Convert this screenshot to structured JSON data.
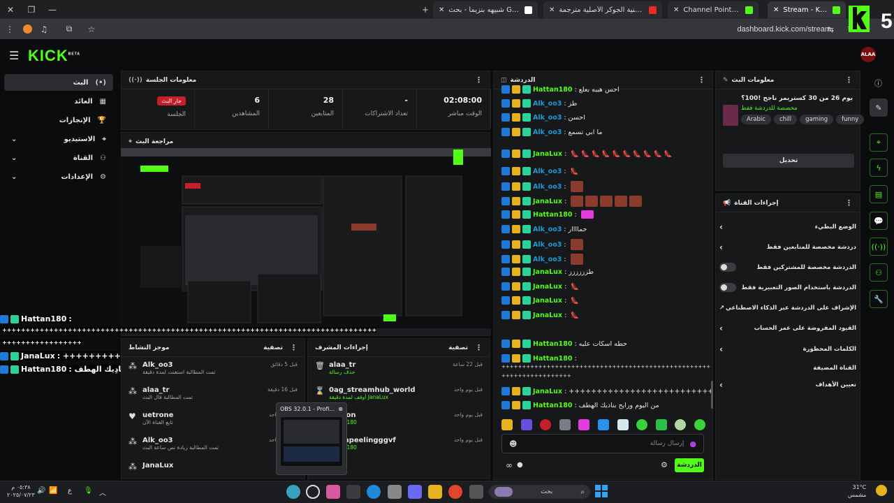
{
  "browser": {
    "tabs": [
      {
        "title": "Stream - Kick Dashboard",
        "active": true
      },
      {
        "title": "Channel Points - Kick Dashboard",
        "active": false
      },
      {
        "title": "اغنية الجوكر الأصلية مترجمة - YouTube",
        "active": false
      },
      {
        "title": "شبيهه بنزيما - بحث Google",
        "active": false
      }
    ],
    "url": "dashboard.kick.com/stream",
    "colors": {
      "accent": "#53fc18",
      "live": "#c81e2a"
    }
  },
  "brand": {
    "logo": "KICK",
    "logo_sup": "BETA",
    "avatar_label": "ALAA",
    "corner_badge": "5"
  },
  "nav": {
    "items": [
      {
        "label": "البث",
        "icon": "broadcast-icon",
        "selected": true
      },
      {
        "label": "العائد",
        "icon": "revenue-icon",
        "selected": false
      },
      {
        "label": "الإنجازات",
        "icon": "trophy-icon",
        "selected": false
      },
      {
        "label": "الاستيديو",
        "icon": "camera-icon",
        "selected": false
      },
      {
        "label": "القناة",
        "icon": "channel-icon",
        "selected": false
      },
      {
        "label": "الإعدادات",
        "icon": "gear-icon",
        "selected": false
      }
    ]
  },
  "session": {
    "title": "معلومات الجلسة",
    "stats": [
      {
        "label": "الجلسة",
        "value": "جار البث",
        "badge": true
      },
      {
        "label": "المشاهدين",
        "value": "6"
      },
      {
        "label": "المتابعين",
        "value": "28"
      },
      {
        "label": "تعداد الاشتراكات",
        "value": "-"
      },
      {
        "label": "الوقت مباشر",
        "value": "02:08:00"
      }
    ]
  },
  "preview": {
    "title": "مراجعة البث"
  },
  "overlay": {
    "lines": [
      {
        "user": "Hattan180",
        "text": ":"
      },
      {
        "user": "",
        "text": "++++++++++++++++++++++++++++++++++++++++++++++++++++++++++++++++++++++++++++++++"
      },
      {
        "user": "",
        "text": "+++++++++++++++++"
      },
      {
        "user": "JanaLux",
        "text": ": ++++++++++++++++++++++++"
      },
      {
        "user": "Hattan180",
        "text": ": من اليوم ورايح بنادِيك الهطف"
      }
    ]
  },
  "activity": {
    "title": "موجز النشاط",
    "filter": "تصفية",
    "items": [
      {
        "user": "Alk_oo3",
        "desc": "تمت المطالبة استغنت لمدة دقيقة",
        "time": "قبل 5 دقائق",
        "icon": "points-icon"
      },
      {
        "user": "alaa_tr",
        "desc": "تمت المطالبة قال البث",
        "time": "قبل 16 دقيقة",
        "icon": "points-icon"
      },
      {
        "user": "uetrone",
        "desc": "تابع القناة الآن",
        "time": "قبل يوم واحد",
        "icon": "heart-icon"
      },
      {
        "user": "Alk_oo3",
        "desc": "تمت المطالبة زيادة نص ساعة البث",
        "time": "قبل يوم واحد",
        "icon": "points-icon"
      },
      {
        "user": "JanaLux",
        "desc": "",
        "time": "",
        "icon": "points-icon"
      }
    ]
  },
  "modactions": {
    "title": "إجراءات المشرف",
    "filter": "تصفية",
    "items": [
      {
        "user": "alaa_tr",
        "desc": "حذف رسالة",
        "time": "قبل 22 ساعة",
        "icon": "trash-icon"
      },
      {
        "user": "0ag_streamhub_world",
        "desc": "أوقف لمدة دقيقة JanaLux",
        "time": "قبل يوم واحد",
        "icon": "hourglass-icon"
      },
      {
        "user": "...nson",
        "desc": "Hattan180",
        "time": "قبل يوم واحد",
        "icon": "user-icon"
      },
      {
        "user": "...ompeelingggvf",
        "desc": "Hattan180",
        "time": "قبل يوم واحد",
        "icon": "user-icon"
      }
    ]
  },
  "obs": {
    "title": "OBS 32.0.1 - Profi..."
  },
  "chat": {
    "title": "الدردشة",
    "messages": [
      {
        "user": "Hattan180",
        "text": "احس هيبه بعلع",
        "emotes": 0,
        "color": "#53fc18"
      },
      {
        "user": "Alk_oo3",
        "text": "طز",
        "emotes": 0,
        "color": "#1e9ad6"
      },
      {
        "user": "Alk_oo3",
        "text": "احسن",
        "emotes": 0,
        "color": "#1e9ad6"
      },
      {
        "user": "Alk_oo3",
        "text": "ما ابي تسمع",
        "emotes": 0,
        "color": "#1e9ad6"
      },
      {
        "user": "JanaLux",
        "text": "",
        "emotes": 0,
        "color": "#53fc18",
        "heels": 10
      },
      {
        "user": "Alk_oo3",
        "text": "",
        "emotes": 0,
        "color": "#1e9ad6",
        "heels": 1
      },
      {
        "user": "Alk_oo3",
        "text": "",
        "emotes": 1,
        "color": "#1e9ad6"
      },
      {
        "user": "JanaLux",
        "text": "",
        "emotes": 5,
        "color": "#53fc18"
      },
      {
        "user": "Hattan180",
        "text": "",
        "emotes": 0,
        "pink": 1,
        "color": "#53fc18"
      },
      {
        "user": "Alk_oo3",
        "text": "حماااار",
        "emotes": 0,
        "color": "#1e9ad6"
      },
      {
        "user": "Alk_oo3",
        "text": "",
        "emotes": 1,
        "color": "#1e9ad6"
      },
      {
        "user": "Alk_oo3",
        "text": "",
        "emotes": 1,
        "color": "#1e9ad6"
      },
      {
        "user": "JanaLux",
        "text": "طزززززز",
        "emotes": 0,
        "color": "#53fc18"
      },
      {
        "user": "JanaLux",
        "text": "",
        "emotes": 0,
        "color": "#53fc18",
        "heels": 1
      },
      {
        "user": "JanaLux",
        "text": "",
        "emotes": 0,
        "color": "#53fc18",
        "heels": 1
      },
      {
        "user": "JanaLux",
        "text": "",
        "emotes": 0,
        "color": "#53fc18",
        "heels": 1
      },
      {
        "user": "Hattan180",
        "text": "حطه اسكات عليه",
        "emotes": 0,
        "color": "#53fc18"
      },
      {
        "user": "Hattan180",
        "text": "",
        "emotes": 0,
        "color": "#53fc18"
      }
    ],
    "tail": [
      {
        "user": "",
        "text": "++++++++++++++++++++++++++++++++++++++++++++++++++++++++++++++++"
      },
      {
        "user": "",
        "text": "+++++++++++++++++"
      },
      {
        "user": "JanaLux",
        "text": "++++++++++++++++++++++++++"
      },
      {
        "user": "Hattan180",
        "text": "من اليوم ورايح بناديك الهطف"
      }
    ],
    "input_placeholder": "إرسال رسالة",
    "send_label": "الدردشة"
  },
  "streaminfo": {
    "title": "معلومات البث",
    "stream_title": "يوم 26 من 30 كستريمر ناجح !100؟",
    "category": "مخصصة للدردشة فقط",
    "tags": [
      "Arabic",
      "chill",
      "gaming",
      "funny"
    ],
    "edit_label": "تحديل"
  },
  "channelactions": {
    "title": "إجراءات القناة",
    "rows": [
      {
        "label": "الوضع البطيء",
        "control": "chevron"
      },
      {
        "label": "دردشة مخصصة للمتابعين فقط",
        "control": "chevron"
      },
      {
        "label": "الدردشة مخصصة للمشتركين فقط",
        "control": "toggle"
      },
      {
        "label": "الدردشة باستخدام الصور التعبيرية فقط",
        "control": "toggle"
      },
      {
        "label": "الإشراف على الدردشة عبر الذكاء الاصطناعي",
        "control": "external"
      },
      {
        "label": "القيود المفروضة على عمر الحساب",
        "control": "chevron"
      },
      {
        "label": "الكلمات المحظورة",
        "control": "chevron"
      },
      {
        "label": "القناة المضيفة",
        "control": "none"
      },
      {
        "label": "تعيين الأهداف",
        "control": "chevron"
      }
    ]
  },
  "taskbar": {
    "search_placeholder": "بحث",
    "weather_temp": "31°C",
    "weather_desc": "مشمس",
    "time": "٠٥:٣٨ م",
    "date": "٢٠٢٥/٠٧/٢٣",
    "lang": "ع"
  }
}
